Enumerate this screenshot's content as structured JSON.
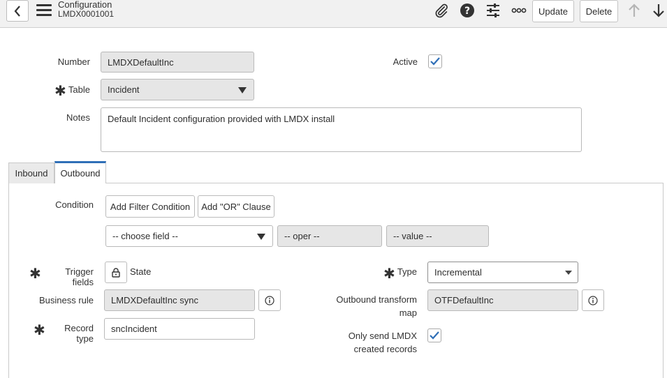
{
  "header": {
    "record_type": "Configuration",
    "record_number": "LMDX0001001",
    "update_label": "Update",
    "delete_label": "Delete"
  },
  "form": {
    "number_label": "Number",
    "number_value": "LMDXDefaultInc",
    "active_label": "Active",
    "active_checked": true,
    "table_label": "Table",
    "table_value": "Incident",
    "notes_label": "Notes",
    "notes_value": "Default Incident configuration provided with LMDX install"
  },
  "tabs": [
    {
      "label": "Inbound",
      "active": false
    },
    {
      "label": "Outbound",
      "active": true
    }
  ],
  "outbound": {
    "condition_label": "Condition",
    "add_filter_label": "Add Filter Condition",
    "add_or_label": "Add \"OR\" Clause",
    "choose_field_placeholder": "-- choose field --",
    "oper_placeholder": "-- oper --",
    "value_placeholder": "-- value --",
    "trigger_fields_label": "Trigger fields",
    "trigger_fields_value": "State",
    "type_label": "Type",
    "type_value": "Incremental",
    "type_options": [
      "Incremental"
    ],
    "business_rule_label": "Business rule",
    "business_rule_value": "LMDXDefaultInc sync",
    "outbound_map_label_line1": "Outbound transform",
    "outbound_map_label_line2": "map",
    "outbound_map_value": "OTFDefaultInc",
    "record_type_label": "Record type",
    "record_type_value": "sncIncident",
    "only_send_label_line1": "Only send LMDX",
    "only_send_label_line2": "created records",
    "only_send_checked": true
  },
  "colors": {
    "accent": "#2f6fb7",
    "header_bg": "#f1f1f1",
    "readonly_bg": "#e6e6e6"
  },
  "icons": {
    "back": "chevron-left-icon",
    "menu": "hamburger-menu-icon",
    "attach": "paperclip-icon",
    "help": "question-circle-icon",
    "personalize": "sliders-icon",
    "more": "more-options-icon",
    "prev": "arrow-up-icon",
    "next": "arrow-down-icon",
    "lock": "lock-icon",
    "info": "info-icon",
    "check": "checkmark-icon"
  }
}
